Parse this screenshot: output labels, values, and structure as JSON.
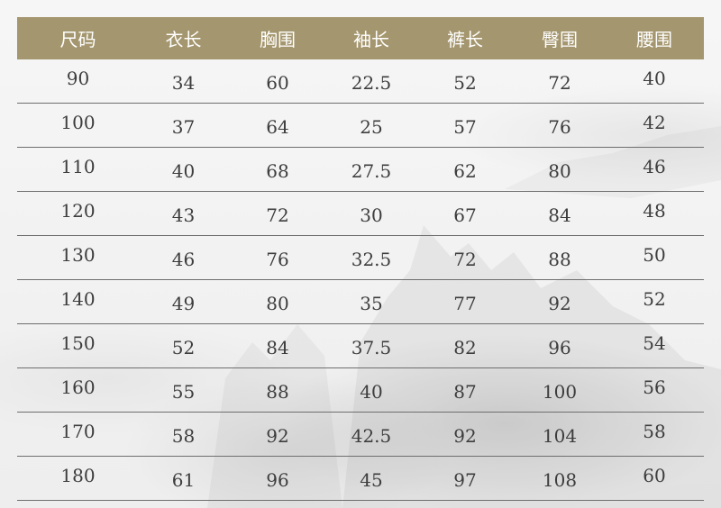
{
  "table": {
    "headers": [
      "尺码",
      "衣长",
      "胸围",
      "袖长",
      "裤长",
      "臀围",
      "腰围"
    ],
    "rows": [
      [
        "90",
        "34",
        "60",
        "22.5",
        "52",
        "72",
        "40"
      ],
      [
        "100",
        "37",
        "64",
        "25",
        "57",
        "76",
        "42"
      ],
      [
        "110",
        "40",
        "68",
        "27.5",
        "62",
        "80",
        "46"
      ],
      [
        "120",
        "43",
        "72",
        "30",
        "67",
        "84",
        "48"
      ],
      [
        "130",
        "46",
        "76",
        "32.5",
        "72",
        "88",
        "50"
      ],
      [
        "140",
        "49",
        "80",
        "35",
        "77",
        "92",
        "52"
      ],
      [
        "150",
        "52",
        "84",
        "37.5",
        "82",
        "96",
        "54"
      ],
      [
        "160",
        "55",
        "88",
        "40",
        "87",
        "100",
        "56"
      ],
      [
        "170",
        "58",
        "92",
        "42.5",
        "92",
        "104",
        "58"
      ],
      [
        "180",
        "61",
        "96",
        "45",
        "97",
        "108",
        "60"
      ]
    ]
  },
  "colors": {
    "header_bg": "#a4966e",
    "header_text": "#ffffff",
    "row_divider": "#6e6e6e",
    "body_text": "#3d3d3d"
  }
}
